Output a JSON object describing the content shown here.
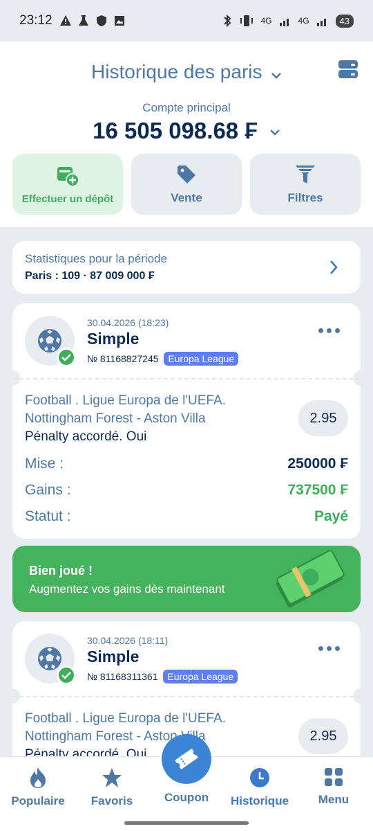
{
  "status_bar": {
    "time": "23:12",
    "battery": "43",
    "net1": "4G",
    "net2": "4G"
  },
  "header": {
    "title": "Historique des paris",
    "account_label": "Compte principal",
    "balance": "16 505 098.68 ₣",
    "actions": {
      "deposit": "Effectuer un dépôt",
      "sale": "Vente",
      "filters": "Filtres"
    }
  },
  "stats": {
    "title": "Statistiques pour la période",
    "summary": "Paris : 109 · 87 009 000 ₣"
  },
  "bets": [
    {
      "date": "30.04.2026 (18:23)",
      "type": "Simple",
      "number": "№ 81168827245",
      "league": "Europa League",
      "event_line1": "Football . Ligue Europa de l'UEFA.",
      "event_line2": "Nottingham Forest - Aston Villa",
      "selection": "Pénalty accordé. Oui",
      "odds": "2.95",
      "stake_label": "Mise :",
      "stake": "250000 ₣",
      "gains_label": "Gains :",
      "gains": "737500 ₣",
      "status_label": "Statut :",
      "status": "Payé"
    },
    {
      "date": "30.04.2026 (18:11)",
      "type": "Simple",
      "number": "№ 81168311361",
      "league": "Europa League",
      "event_line1": "Football . Ligue Europa de l'UEFA.",
      "event_line2": "Nottingham Forest - Aston Villa",
      "selection": "Pénalty accordé. Oui",
      "odds": "2.95"
    }
  ],
  "banner": {
    "title": "Bien joué !",
    "subtitle": "Augmentez vos gains dès maintenant"
  },
  "nav": {
    "popular": "Populaire",
    "favorites": "Favoris",
    "coupon": "Coupon",
    "history": "Historique",
    "menu": "Menu"
  },
  "colors": {
    "accent": "#4e78a3",
    "success": "#3fae5c",
    "active": "#3b79c9",
    "badge": "#5f7ff0"
  }
}
